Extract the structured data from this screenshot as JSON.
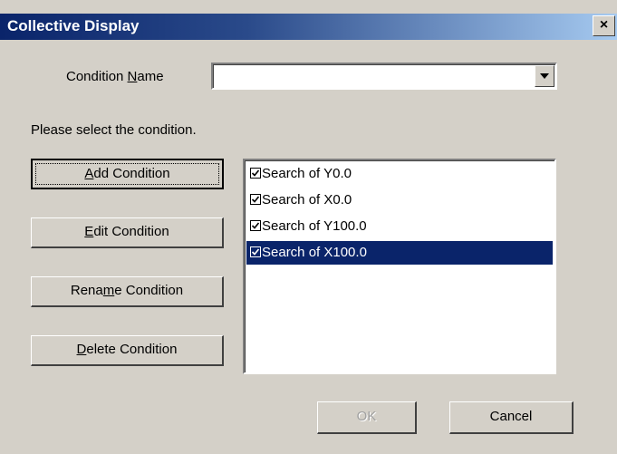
{
  "window": {
    "title": "Collective Display",
    "close_glyph": "×"
  },
  "condition_name": {
    "label_prefix": "Condition ",
    "label_mnemonic": "N",
    "label_suffix": "ame",
    "value": ""
  },
  "prompt": "Please select the condition.",
  "buttons": {
    "add": {
      "prefix": "",
      "mnemonic": "A",
      "suffix": "dd Condition"
    },
    "edit": {
      "prefix": "",
      "mnemonic": "E",
      "suffix": "dit Condition"
    },
    "rename": {
      "prefix": "Rena",
      "mnemonic": "m",
      "suffix": "e Condition"
    },
    "delete": {
      "prefix": "",
      "mnemonic": "D",
      "suffix": "elete Condition"
    },
    "ok": "OK",
    "cancel": "Cancel"
  },
  "conditions": [
    {
      "label": "Search of Y0.0",
      "checked": true,
      "selected": false
    },
    {
      "label": "Search of X0.0",
      "checked": true,
      "selected": false
    },
    {
      "label": "Search of Y100.0",
      "checked": true,
      "selected": false
    },
    {
      "label": "Search of X100.0",
      "checked": true,
      "selected": true
    }
  ],
  "colors": {
    "selection": "#0a246a",
    "face": "#d4d0c8"
  }
}
